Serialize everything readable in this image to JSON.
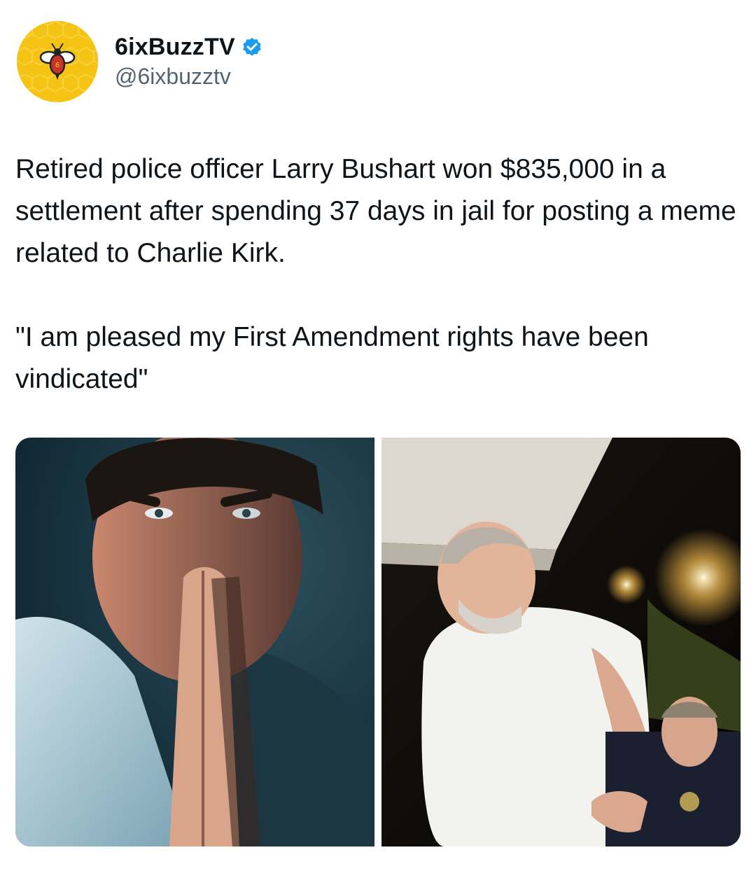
{
  "author": {
    "display_name": "6ixBuzzTV",
    "handle": "@6ixbuzztv",
    "verified": true,
    "avatar_icon": "bee-logo-icon",
    "avatar_color": "#f5c313",
    "verified_color": "#1d9bf0"
  },
  "tweet": {
    "paragraph_1": "Retired police officer Larry Bushart won $835,000 in a settlement after spending 37 days in jail for posting a meme related to Charlie Kirk.",
    "paragraph_2": "\"I am pleased my First Amendment rights have been vindicated\""
  },
  "media": {
    "count": 2
  }
}
